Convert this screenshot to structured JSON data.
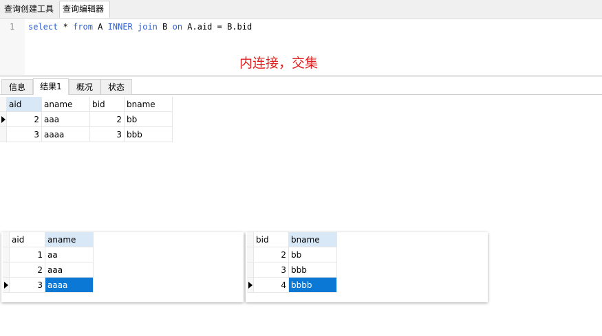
{
  "top_tabs": [
    "查询创建工具",
    "查询编辑器"
  ],
  "editor": {
    "line_number": "1",
    "tokens": [
      {
        "t": "select",
        "kw": true
      },
      {
        "t": " * ",
        "kw": false
      },
      {
        "t": "from",
        "kw": true
      },
      {
        "t": " A ",
        "kw": false
      },
      {
        "t": "INNER",
        "kw": true
      },
      {
        "t": " ",
        "kw": false
      },
      {
        "t": "join",
        "kw": true
      },
      {
        "t": " B ",
        "kw": false
      },
      {
        "t": "on",
        "kw": true
      },
      {
        "t": " A.aid = B.bid",
        "kw": false
      }
    ],
    "note": "内连接，交集"
  },
  "result_tabs": [
    "信息",
    "结果1",
    "概况",
    "状态"
  ],
  "result_grid": {
    "columns": [
      "aid",
      "aname",
      "bid",
      "bname"
    ],
    "rows": [
      [
        "2",
        "aaa",
        "2",
        "bb"
      ],
      [
        "3",
        "aaaa",
        "3",
        "bbb"
      ]
    ]
  },
  "table_a": {
    "columns": [
      "aid",
      "aname"
    ],
    "rows": [
      [
        "1",
        "aa"
      ],
      [
        "2",
        "aaa"
      ],
      [
        "3",
        "aaaa"
      ]
    ]
  },
  "table_b": {
    "columns": [
      "bid",
      "bname"
    ],
    "rows": [
      [
        "2",
        "bb"
      ],
      [
        "3",
        "bbb"
      ],
      [
        "4",
        "bbbb"
      ]
    ]
  },
  "colors": {
    "keyword": "#2f5fd0",
    "note": "#e02020",
    "selection": "#0a78d4",
    "header_selected": "#d9e8f7"
  }
}
